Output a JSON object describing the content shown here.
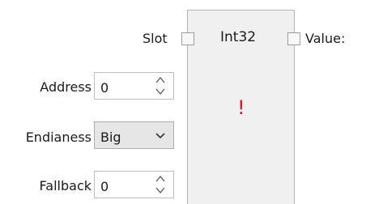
{
  "node": {
    "title": "Int32",
    "error_glyph": "!",
    "input_port_label": "Slot",
    "output_port_label": "Value:"
  },
  "params": {
    "address": {
      "label": "Address",
      "value": "0"
    },
    "endianess": {
      "label": "Endianess",
      "value": "Big"
    },
    "fallback": {
      "label": "Fallback",
      "value": "0"
    }
  },
  "icons": {
    "spin_up": "chevron-up-icon",
    "spin_down": "chevron-down-icon",
    "combo_arrow": "chevron-down-icon"
  },
  "colors": {
    "error": "#e81123",
    "node_background": "#f0f0f0"
  }
}
